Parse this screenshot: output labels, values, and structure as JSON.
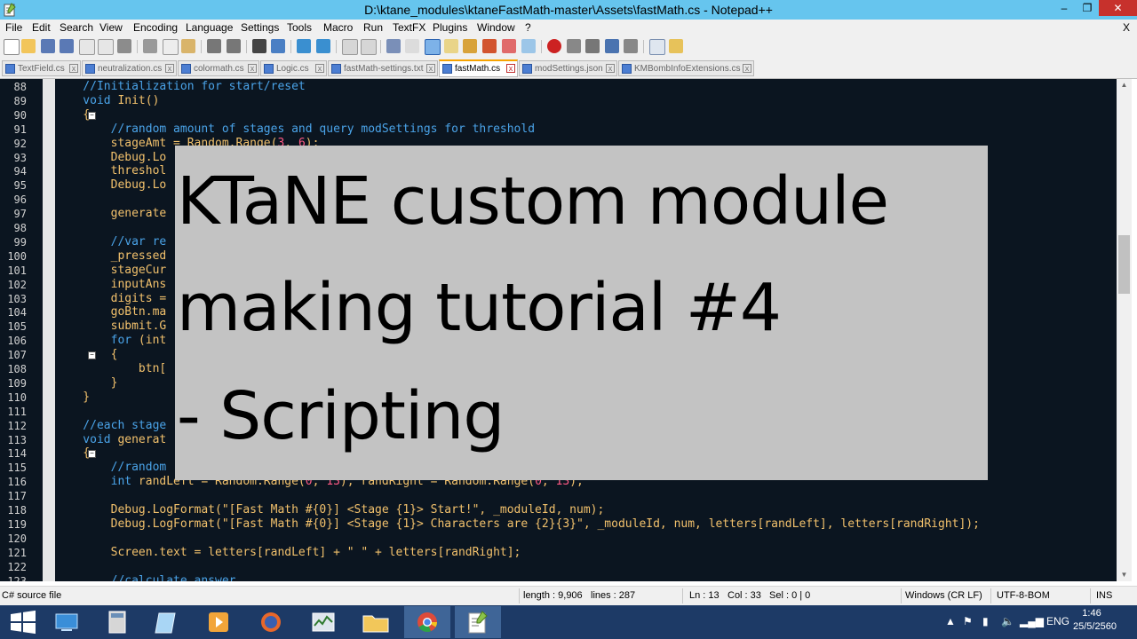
{
  "window": {
    "title": "D:\\ktane_modules\\ktaneFastMath-master\\Assets\\fastMath.cs - Notepad++",
    "minimize": "–",
    "maximize": "❐",
    "close": "✕"
  },
  "menu": {
    "items": [
      "File",
      "Edit",
      "Search",
      "View",
      "Encoding",
      "Language",
      "Settings",
      "Tools",
      "Macro",
      "Run",
      "TextFX",
      "Plugins",
      "Window",
      "?"
    ],
    "close_doc": "X"
  },
  "tabs": [
    {
      "label": "TextField.cs",
      "active": false
    },
    {
      "label": "neutralization.cs",
      "active": false
    },
    {
      "label": "colormath.cs",
      "active": false
    },
    {
      "label": "Logic.cs",
      "active": false
    },
    {
      "label": "fastMath-settings.txt",
      "active": false
    },
    {
      "label": "fastMath.cs",
      "active": true
    },
    {
      "label": "modSettings.json",
      "active": false
    },
    {
      "label": "KMBombInfoExtensions.cs",
      "active": false
    }
  ],
  "editor": {
    "line_numbers": [
      "88",
      "89",
      "90",
      "91",
      "92",
      "93",
      "94",
      "95",
      "96",
      "97",
      "98",
      "99",
      "100",
      "101",
      "102",
      "103",
      "104",
      "105",
      "106",
      "107",
      "108",
      "109",
      "110",
      "111",
      "112",
      "113",
      "114",
      "115",
      "116",
      "117",
      "118",
      "119",
      "120",
      "121",
      "122",
      "123"
    ],
    "fold_markers": {
      "90": "−",
      "107": "−",
      "114": "−"
    },
    "lines": [
      [
        [
          "cm",
          "    //Initialization for start/reset"
        ]
      ],
      [
        [
          "kw",
          "    void "
        ],
        [
          "pl",
          "Init()"
        ]
      ],
      [
        [
          "pl",
          "    {"
        ]
      ],
      [
        [
          "cm",
          "        //random amount of stages and query modSettings for threshold"
        ]
      ],
      [
        [
          "pl",
          "        stageAmt = Random.Range("
        ],
        [
          "num",
          "3"
        ],
        [
          "pl",
          ", "
        ],
        [
          "num",
          "6"
        ],
        [
          "pl",
          ");"
        ]
      ],
      [
        [
          "pl",
          "        Debug.Lo"
        ]
      ],
      [
        [
          "pl",
          "        threshol"
        ]
      ],
      [
        [
          "pl",
          "        Debug.Lo"
        ]
      ],
      [
        [
          "pl",
          ""
        ]
      ],
      [
        [
          "pl",
          "        generate"
        ]
      ],
      [
        [
          "pl",
          ""
        ]
      ],
      [
        [
          "cm",
          "        //var re"
        ]
      ],
      [
        [
          "pl",
          "        _pressed"
        ]
      ],
      [
        [
          "pl",
          "        stageCur"
        ]
      ],
      [
        [
          "pl",
          "        inputAns"
        ]
      ],
      [
        [
          "pl",
          "        digits ="
        ]
      ],
      [
        [
          "pl",
          "        goBtn.ma"
        ]
      ],
      [
        [
          "pl",
          "        submit.G"
        ]
      ],
      [
        [
          "kw",
          "        for "
        ],
        [
          "pl",
          "(int"
        ]
      ],
      [
        [
          "pl",
          "        {"
        ]
      ],
      [
        [
          "pl",
          "            btn["
        ]
      ],
      [
        [
          "pl",
          "        }"
        ]
      ],
      [
        [
          "pl",
          "    }"
        ]
      ],
      [
        [
          "pl",
          ""
        ]
      ],
      [
        [
          "cm",
          "    //each stage"
        ]
      ],
      [
        [
          "kw",
          "    void "
        ],
        [
          "pl",
          "generat"
        ]
      ],
      [
        [
          "pl",
          "    {"
        ]
      ],
      [
        [
          "cm",
          "        //random"
        ]
      ],
      [
        [
          "kw",
          "        int "
        ],
        [
          "pl",
          "randLeft = Random.Range("
        ],
        [
          "num",
          "0"
        ],
        [
          "pl",
          ", "
        ],
        [
          "num",
          "13"
        ],
        [
          "pl",
          "), randRight = Random.Range("
        ],
        [
          "num",
          "0"
        ],
        [
          "pl",
          ", "
        ],
        [
          "num",
          "13"
        ],
        [
          "pl",
          ");"
        ]
      ],
      [
        [
          "pl",
          ""
        ]
      ],
      [
        [
          "pl",
          "        Debug.LogFormat(\"[Fast Math #{0}] <Stage {1}> Start!\", _moduleId, num);"
        ]
      ],
      [
        [
          "pl",
          "        Debug.LogFormat(\"[Fast Math #{0}] <Stage {1}> Characters are {2}{3}\", _moduleId, num, letters[randLeft], letters[randRight]);"
        ]
      ],
      [
        [
          "pl",
          ""
        ]
      ],
      [
        [
          "pl",
          "        Screen.text = letters[randLeft] + \" \" + letters[randRight];"
        ]
      ],
      [
        [
          "pl",
          ""
        ]
      ],
      [
        [
          "cm",
          "        //calculate answer"
        ]
      ]
    ]
  },
  "overlay": {
    "line1": "KTaNE custom module",
    "line2": "making tutorial #4",
    "line3": "- Scripting"
  },
  "status": {
    "file_type": "C# source file",
    "length": "length : 9,906",
    "lines": "lines : 287",
    "ln": "Ln : 13",
    "col": "Col : 33",
    "sel": "Sel : 0 | 0",
    "eol": "Windows (CR LF)",
    "encoding": "UTF-8-BOM",
    "mode": "INS"
  },
  "taskbar": {
    "lang": "ENG",
    "time": "1:46",
    "date": "25/5/2560"
  },
  "colors": {
    "titlebar": "#66c5ee",
    "editor_bg": "#0b1520",
    "comment": "#4aa3e8",
    "text": "#f2c16c",
    "number": "#ff5a85",
    "overlay_bg": "#c3c3c3",
    "taskbar": "#1d3a66"
  }
}
